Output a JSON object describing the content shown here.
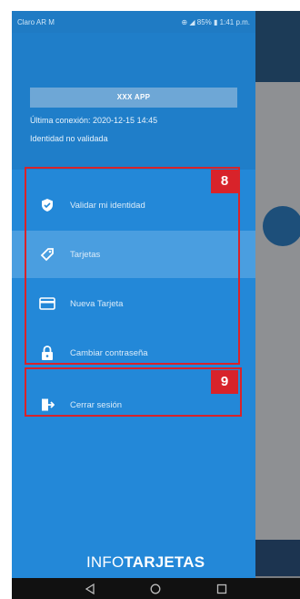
{
  "status_bar": {
    "left": "Claro AR M",
    "right": "⊕ ◢ 85% ▮ 1:41 p.m."
  },
  "drawer": {
    "app_name": "XXX APP",
    "last_connection": "Última conexión: 2020-12-15 14:45",
    "identity_status": "Identidad no validada"
  },
  "menu": {
    "items": [
      {
        "label": "Validar mi identidad",
        "icon": "shield-check-icon",
        "active": false
      },
      {
        "label": "Tarjetas",
        "icon": "tag-icon",
        "active": true
      },
      {
        "label": "Nueva Tarjeta",
        "icon": "credit-card-icon",
        "active": false
      },
      {
        "label": "Cambiar contraseña",
        "icon": "lock-icon",
        "active": false
      },
      {
        "label": "Cerrar sesión",
        "icon": "logout-icon",
        "active": false
      }
    ]
  },
  "annotations": {
    "group_a": "8",
    "group_b": "9"
  },
  "brand": {
    "part1": "INFO",
    "part2": "TARJETAS"
  },
  "colors": {
    "drawer_bg": "#2388d8",
    "active_item_bg": "#4a9ee0",
    "annotation_red": "#d8232a"
  }
}
